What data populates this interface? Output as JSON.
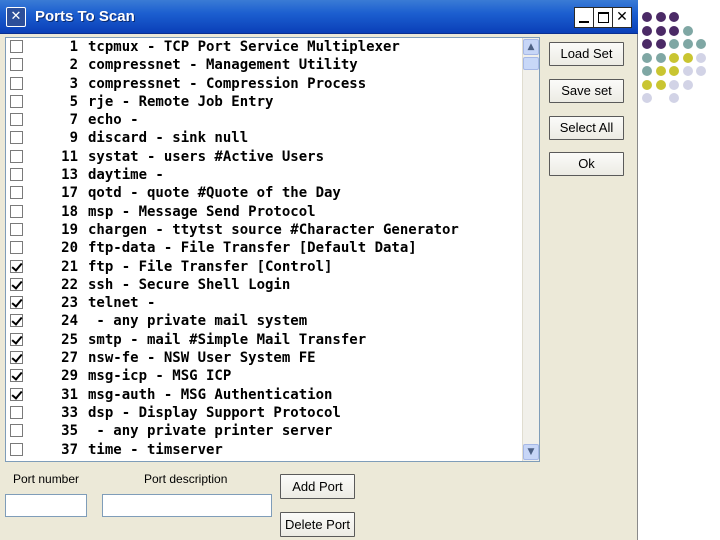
{
  "window": {
    "title": "Ports To Scan",
    "app_icon_glyph": "✕",
    "controls": {
      "minimize_icon": "minimize-icon",
      "maximize_icon": "maximize-icon",
      "close_glyph": "✕"
    }
  },
  "ports": [
    {
      "checked": false,
      "number": "1",
      "description": "tcpmux - TCP Port Service Multiplexer"
    },
    {
      "checked": false,
      "number": "2",
      "description": "compressnet - Management Utility"
    },
    {
      "checked": false,
      "number": "3",
      "description": "compressnet - Compression Process"
    },
    {
      "checked": false,
      "number": "5",
      "description": "rje - Remote Job Entry"
    },
    {
      "checked": false,
      "number": "7",
      "description": "echo -"
    },
    {
      "checked": false,
      "number": "9",
      "description": "discard - sink null"
    },
    {
      "checked": false,
      "number": "11",
      "description": "systat - users #Active Users"
    },
    {
      "checked": false,
      "number": "13",
      "description": "daytime -"
    },
    {
      "checked": false,
      "number": "17",
      "description": "qotd - quote #Quote of the Day"
    },
    {
      "checked": false,
      "number": "18",
      "description": "msp - Message Send Protocol"
    },
    {
      "checked": false,
      "number": "19",
      "description": "chargen - ttytst source #Character Generator"
    },
    {
      "checked": false,
      "number": "20",
      "description": "ftp-data - File Transfer [Default Data]"
    },
    {
      "checked": true,
      "number": "21",
      "description": "ftp - File Transfer [Control]"
    },
    {
      "checked": true,
      "number": "22",
      "description": "ssh - Secure Shell Login"
    },
    {
      "checked": true,
      "number": "23",
      "description": "telnet -"
    },
    {
      "checked": true,
      "number": "24",
      "description": " - any private mail system"
    },
    {
      "checked": true,
      "number": "25",
      "description": "smtp - mail #Simple Mail Transfer"
    },
    {
      "checked": true,
      "number": "27",
      "description": "nsw-fe - NSW User System FE"
    },
    {
      "checked": true,
      "number": "29",
      "description": "msg-icp - MSG ICP"
    },
    {
      "checked": true,
      "number": "31",
      "description": "msg-auth - MSG Authentication"
    },
    {
      "checked": false,
      "number": "33",
      "description": "dsp - Display Support Protocol"
    },
    {
      "checked": false,
      "number": "35",
      "description": " - any private printer server"
    },
    {
      "checked": false,
      "number": "37",
      "description": "time - timserver"
    }
  ],
  "scrollbar": {
    "up_glyph": "▲",
    "down_glyph": "▼"
  },
  "buttons": {
    "load_set": "Load Set",
    "save_set": "Save set",
    "select_all": "Select All",
    "ok": "Ok",
    "add_port": "Add Port",
    "delete_port": "Delete Port"
  },
  "inputs": {
    "port_number_label": "Port number",
    "port_number_value": "",
    "port_description_label": "Port description",
    "port_description_value": ""
  },
  "decor": {
    "colors": {
      "purple": "#4b2a66",
      "teal": "#7fa7a4",
      "yellow": "#c9c531",
      "lavender": "#d2d3e6"
    },
    "grid": [
      [
        "purple",
        "purple",
        "purple",
        null,
        null,
        null
      ],
      [
        "purple",
        "purple",
        "purple",
        "teal",
        null,
        null
      ],
      [
        "purple",
        "purple",
        "teal",
        "teal",
        "teal",
        null
      ],
      [
        "teal",
        "teal",
        "yellow",
        "yellow",
        "lavender",
        null
      ],
      [
        "teal",
        "yellow",
        "yellow",
        "lavender",
        "lavender",
        null
      ],
      [
        "yellow",
        "yellow",
        "lavender",
        "lavender",
        null,
        null
      ],
      [
        "lavender",
        null,
        "lavender",
        null,
        null,
        null
      ]
    ]
  }
}
